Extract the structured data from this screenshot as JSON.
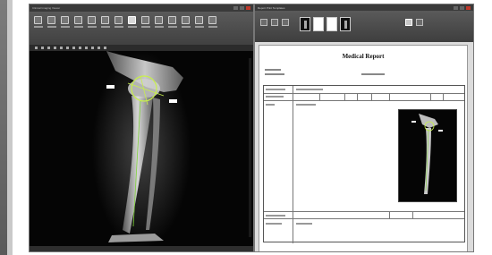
{
  "viewer": {
    "title": "Clinical Imaging Viewer",
    "toolbar_buttons": [
      "Open",
      "Save",
      "Print",
      "Export",
      "Layout",
      "Zoom",
      "Pan",
      "Contrast",
      "Measure",
      "Angle",
      "Ruler",
      "Annotate",
      "Report",
      "Settings"
    ]
  },
  "report_window": {
    "title": "Report  Print  Templates"
  },
  "report": {
    "title": "Medical Report"
  },
  "colors": {
    "measure_overlay": "#c8f04a",
    "window_bg": "#1d1d1d",
    "ribbon": "#4a4a4a"
  }
}
